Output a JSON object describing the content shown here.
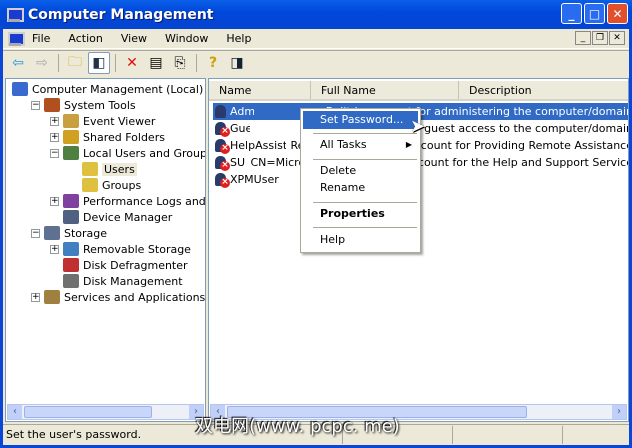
{
  "window": {
    "title": "Computer Management"
  },
  "menu": [
    "File",
    "Action",
    "View",
    "Window",
    "Help"
  ],
  "toolbar": [
    "back-icon",
    "forward-icon",
    "up-folder-icon",
    "show-hide-tree-icon",
    "delete-icon",
    "properties-icon",
    "export-list-icon",
    "help-icon",
    "show-hide-action-pane-icon"
  ],
  "tree": [
    {
      "label": "Computer Management (Local)",
      "level": 0,
      "exp": ""
    },
    {
      "label": "System Tools",
      "level": 1,
      "exp": "-"
    },
    {
      "label": "Event Viewer",
      "level": 2,
      "exp": "+"
    },
    {
      "label": "Shared Folders",
      "level": 2,
      "exp": "+"
    },
    {
      "label": "Local Users and Groups",
      "level": 2,
      "exp": "-"
    },
    {
      "label": "Users",
      "level": 3,
      "exp": "",
      "selected": true
    },
    {
      "label": "Groups",
      "level": 3,
      "exp": ""
    },
    {
      "label": "Performance Logs and Alerts",
      "level": 2,
      "exp": "+"
    },
    {
      "label": "Device Manager",
      "level": 2,
      "exp": ""
    },
    {
      "label": "Storage",
      "level": 1,
      "exp": "-"
    },
    {
      "label": "Removable Storage",
      "level": 2,
      "exp": "+"
    },
    {
      "label": "Disk Defragmenter",
      "level": 2,
      "exp": ""
    },
    {
      "label": "Disk Management",
      "level": 2,
      "exp": ""
    },
    {
      "label": "Services and Applications",
      "level": 1,
      "exp": "+"
    }
  ],
  "columns": [
    "Name",
    "Full Name",
    "Description"
  ],
  "users": [
    {
      "name": "Administrator",
      "full": "",
      "desc": "Built-in account for administering the computer/domain",
      "disabled": false
    },
    {
      "name": "Guest",
      "full": "",
      "desc": "Built-in account for guest access to the computer/domain",
      "disabled": true
    },
    {
      "name": "HelpAssistant",
      "full": "Remote Desktop Help Assi...",
      "desc": "Account for Providing Remote Assistance",
      "disabled": true
    },
    {
      "name": "SUPPORT_38...",
      "full": "CN=Microsoft Corporation...",
      "desc": "This is a vendor's account for the Help and Support Service",
      "disabled": true
    },
    {
      "name": "XPMUser",
      "full": "",
      "desc": "",
      "disabled": true
    }
  ],
  "context_menu": {
    "set_password": "Set Password...",
    "all_tasks": "All Tasks",
    "delete": "Delete",
    "rename": "Rename",
    "properties": "Properties",
    "help": "Help"
  },
  "status": "Set the user's password.",
  "watermark": "双电网(www. pcpc. me)"
}
